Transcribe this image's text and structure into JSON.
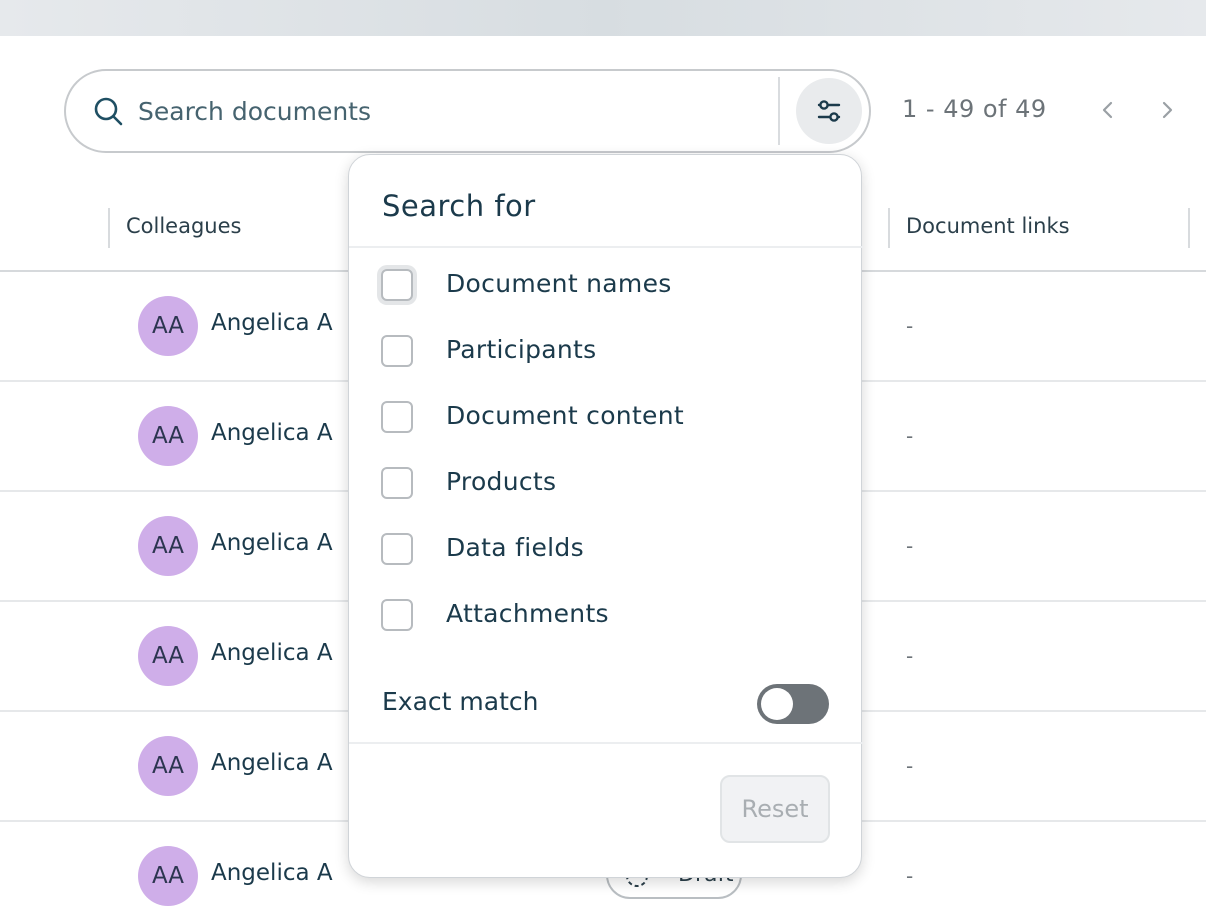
{
  "search": {
    "placeholder": "Search documents"
  },
  "pagination": {
    "range_text": "1 - 49 of 49"
  },
  "table": {
    "columns": {
      "colleagues": "Colleagues",
      "document_links": "Document links"
    },
    "rows": [
      {
        "initials": "AA",
        "name": "Angelica A",
        "link": "-"
      },
      {
        "initials": "AA",
        "name": "Angelica A",
        "link": "-"
      },
      {
        "initials": "AA",
        "name": "Angelica A",
        "link": "-"
      },
      {
        "initials": "AA",
        "name": "Angelica A",
        "link": "-"
      },
      {
        "initials": "AA",
        "name": "Angelica A",
        "link": "-"
      },
      {
        "initials": "AA",
        "name": "Angelica A",
        "link": "-",
        "status": "Draft"
      }
    ]
  },
  "search_filter": {
    "title": "Search for",
    "options": [
      {
        "label": "Document names",
        "checked": false
      },
      {
        "label": "Participants",
        "checked": false
      },
      {
        "label": "Document content",
        "checked": false
      },
      {
        "label": "Products",
        "checked": false
      },
      {
        "label": "Data fields",
        "checked": false
      },
      {
        "label": "Attachments",
        "checked": false
      }
    ],
    "exact_match_label": "Exact match",
    "exact_match_on": false,
    "reset_label": "Reset"
  },
  "colors": {
    "text_primary": "#1b3a4b",
    "avatar_bg": "#cfaee9",
    "toggle_off": "#6d7378"
  }
}
